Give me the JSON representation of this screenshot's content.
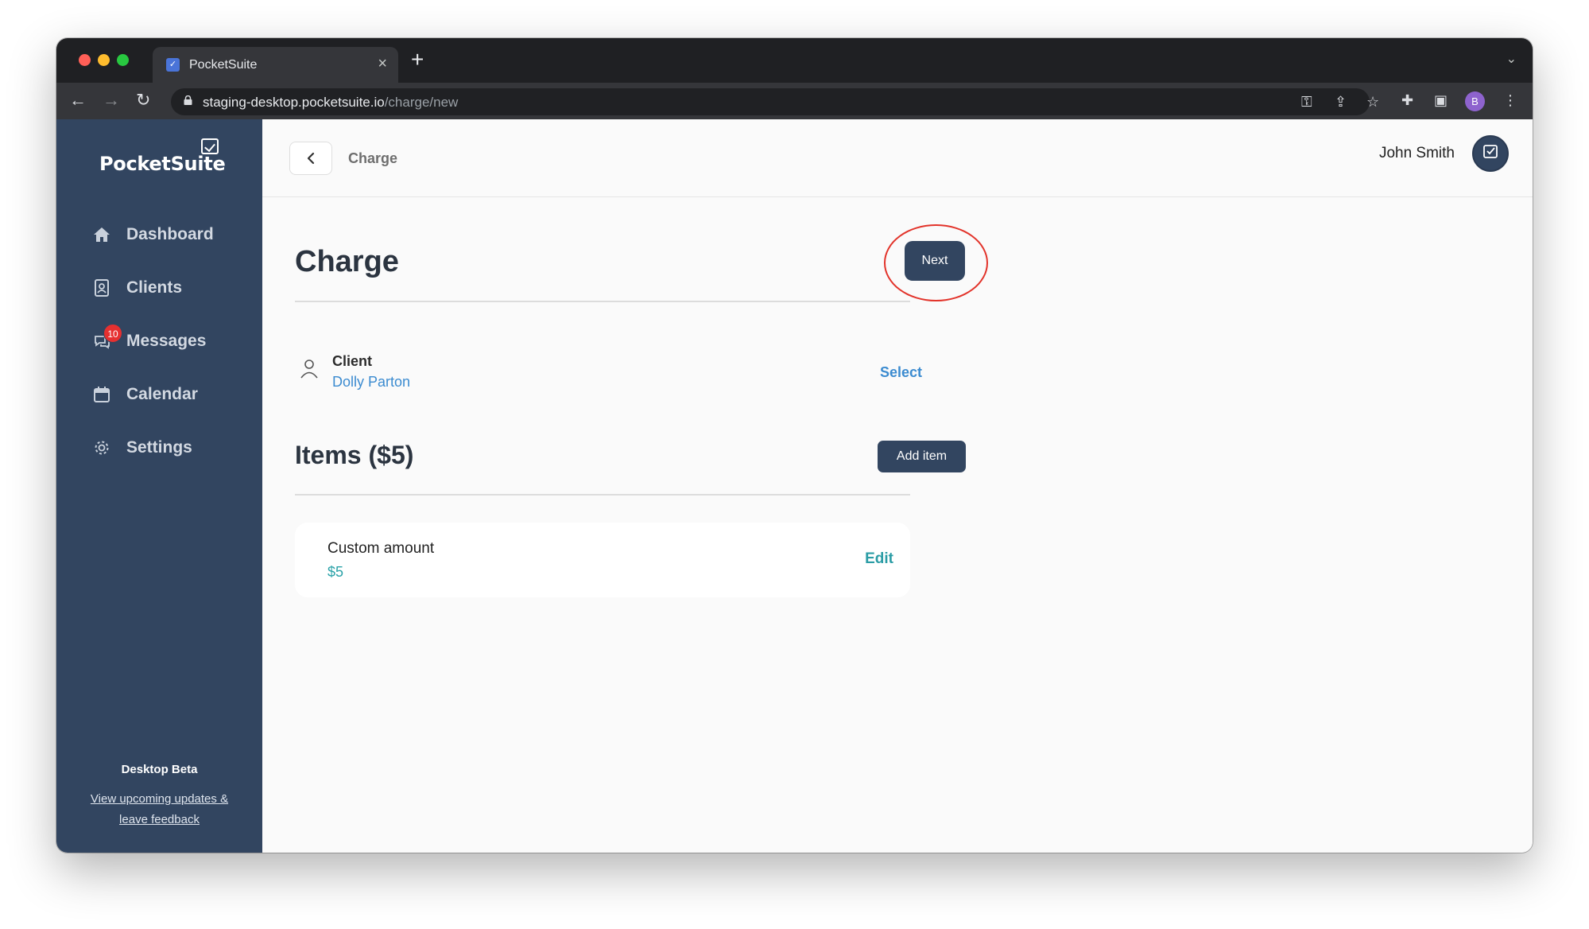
{
  "browser": {
    "tab_title": "PocketSuite",
    "url_host": "staging-desktop.pocketsuite.io",
    "url_path": "/charge/new",
    "profile_initial": "B"
  },
  "sidebar": {
    "logo": "PocketSuite",
    "items": [
      {
        "label": "Dashboard",
        "icon": "home-icon"
      },
      {
        "label": "Clients",
        "icon": "contact-card-icon"
      },
      {
        "label": "Messages",
        "icon": "chat-bubbles-icon",
        "badge": "10"
      },
      {
        "label": "Calendar",
        "icon": "calendar-icon"
      },
      {
        "label": "Settings",
        "icon": "gear-icon"
      }
    ],
    "footer_title": "Desktop Beta",
    "footer_link_line1": "View upcoming updates &",
    "footer_link_line2": "leave feedback"
  },
  "topbar": {
    "breadcrumb": "Charge",
    "user_name": "John Smith"
  },
  "page": {
    "title": "Charge",
    "next_label": "Next",
    "client_label": "Client",
    "client_name": "Dolly Parton",
    "select_label": "Select",
    "items_title": "Items ($5)",
    "add_item_label": "Add item",
    "items": [
      {
        "name": "Custom amount",
        "price": "$5",
        "edit_label": "Edit"
      }
    ]
  },
  "colors": {
    "sidebar_bg": "#324560",
    "primary_button": "#324560",
    "link_blue": "#3b8bd0",
    "link_teal": "#2a9ca5",
    "highlight_ring": "#e2332a",
    "badge_red": "#e63030"
  }
}
